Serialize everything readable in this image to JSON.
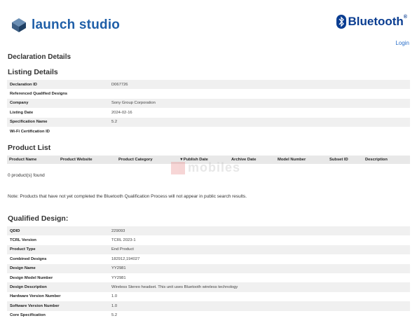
{
  "header": {
    "app_name": "launch studio",
    "brand": "Bluetooth",
    "brand_reg": "®",
    "login": "Login"
  },
  "page_title": "Declaration Details",
  "listing": {
    "title": "Listing Details",
    "rows": [
      {
        "label": "Declaration ID",
        "value": "D067726"
      },
      {
        "label": "Referenced Qualified Designs",
        "value": ""
      },
      {
        "label": "Company",
        "value": "Sony Group Corporation"
      },
      {
        "label": "Listing Date",
        "value": "2024-02-16"
      },
      {
        "label": "Specification Name",
        "value": "5.2"
      },
      {
        "label": "Wi-Fi Certification ID",
        "value": ""
      }
    ]
  },
  "product_list": {
    "title": "Product List",
    "columns": [
      "Product Name",
      "Product Website",
      "Product Category",
      "▼Publish Date",
      "Archive Date",
      "Model Number",
      "Subset ID",
      "Description"
    ],
    "found": "0 product(s) found",
    "note": "Note: Products that have not yet completed the Bluetooth Qualification Process will not appear in public search results."
  },
  "watermark": {
    "text": "mobiles"
  },
  "qualified": {
    "title": "Qualified Design:",
    "rows": [
      {
        "label": "QDID",
        "value": "229093"
      },
      {
        "label": "TCRL Version",
        "value": "TCRL 2023-1"
      },
      {
        "label": "Product Type",
        "value": "End Product"
      },
      {
        "label": "Combined Designs",
        "value": "182912,194027"
      },
      {
        "label": "Design Name",
        "value": "YY2981"
      },
      {
        "label": "Design Model Number",
        "value": "YY2981"
      },
      {
        "label": "Design Description",
        "value": "Wireless Stereo headset. This unit uses Bluetooth wireless technology"
      },
      {
        "label": "Hardware Version Number",
        "value": "1.0"
      },
      {
        "label": "Software Version Number",
        "value": "1.0"
      },
      {
        "label": "Core Specification",
        "value": "5.2"
      }
    ]
  },
  "colors": {
    "accent": "#1f5fa8",
    "brand": "#0a3d91",
    "link": "#2a6fc9",
    "row_alt": "#f0f0f0"
  }
}
